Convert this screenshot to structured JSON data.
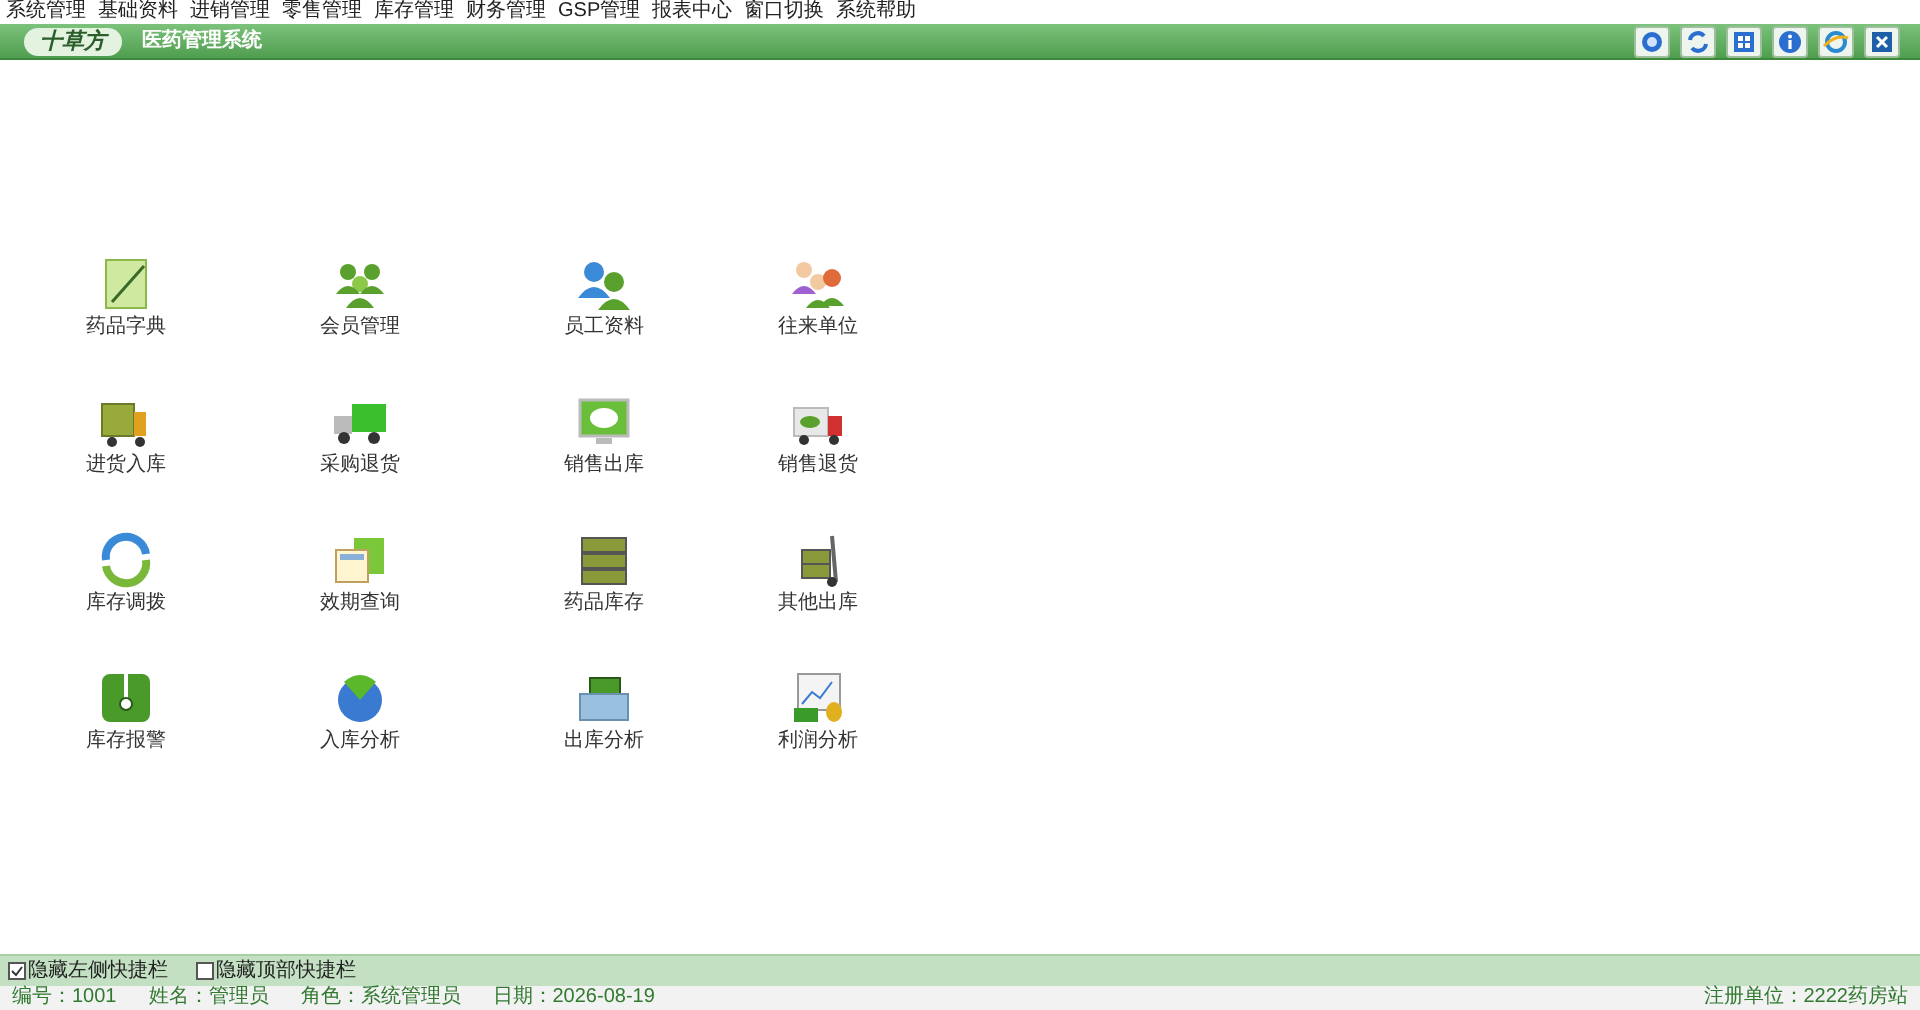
{
  "menu": [
    "系统管理",
    "基础资料",
    "进销管理",
    "零售管理",
    "库存管理",
    "财务管理",
    "GSP管理",
    "报表中心",
    "窗口切换",
    "系统帮助"
  ],
  "header": {
    "logo": "十草方",
    "title": "医药管理系统"
  },
  "shortcuts": [
    {
      "label": "药品字典"
    },
    {
      "label": "会员管理"
    },
    {
      "label": "员工资料"
    },
    {
      "label": "往来单位"
    },
    {
      "label": "进货入库"
    },
    {
      "label": "采购退货"
    },
    {
      "label": "销售出库"
    },
    {
      "label": "销售退货"
    },
    {
      "label": "库存调拨"
    },
    {
      "label": "效期查询"
    },
    {
      "label": "药品库存"
    },
    {
      "label": "其他出库"
    },
    {
      "label": "库存报警"
    },
    {
      "label": "入库分析"
    },
    {
      "label": "出库分析"
    },
    {
      "label": "利润分析"
    }
  ],
  "options": [
    {
      "label": "隐藏左侧快捷栏",
      "checked": true
    },
    {
      "label": "隐藏顶部快捷栏",
      "checked": false
    }
  ],
  "status_bar": {
    "left": [
      "编号：1001",
      "姓名：管理员",
      "角色：系统管理员",
      "日期：2026-08-19"
    ],
    "right": "注册单位：2222药房站"
  }
}
